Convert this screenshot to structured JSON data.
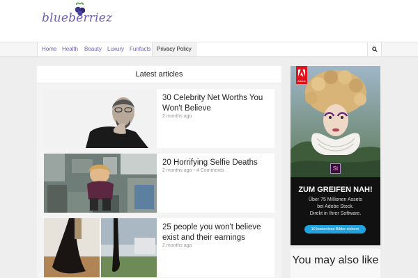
{
  "site": {
    "logo_text": "blueberriez"
  },
  "nav": {
    "items": [
      {
        "label": "Home"
      },
      {
        "label": "Health"
      },
      {
        "label": "Beauty"
      },
      {
        "label": "Luxury"
      },
      {
        "label": "Funfacts"
      },
      {
        "label": "Privacy Policy"
      }
    ],
    "search_icon": "search-icon"
  },
  "main": {
    "heading": "Latest articles",
    "articles": [
      {
        "title": "30 Celebrity Net Worths You Won't Believe",
        "time": "2 months ago",
        "comments": ""
      },
      {
        "title": "20 Horrifying Selfie Deaths",
        "time": "2 months ago",
        "comments": "4 Comments"
      },
      {
        "title": "25 people you won't believe exist and their earnings",
        "time": "2 months ago",
        "comments": ""
      }
    ]
  },
  "ad": {
    "brand": "Adobe",
    "product_mark": "St",
    "headline": "ZUM GREIFEN NAH!",
    "line1": "Über 75 Millionen Assets",
    "line2": "bei Adobe Stock.",
    "line3": "Direkt in Ihrer Software.",
    "cta": "10 kostenlose Bilder sichern"
  },
  "sidebar": {
    "related_heading": "You may also like"
  },
  "colors": {
    "accent": "#6b5fb5",
    "adobe_red": "#e0151b",
    "cta_blue": "#1fa4e0"
  }
}
